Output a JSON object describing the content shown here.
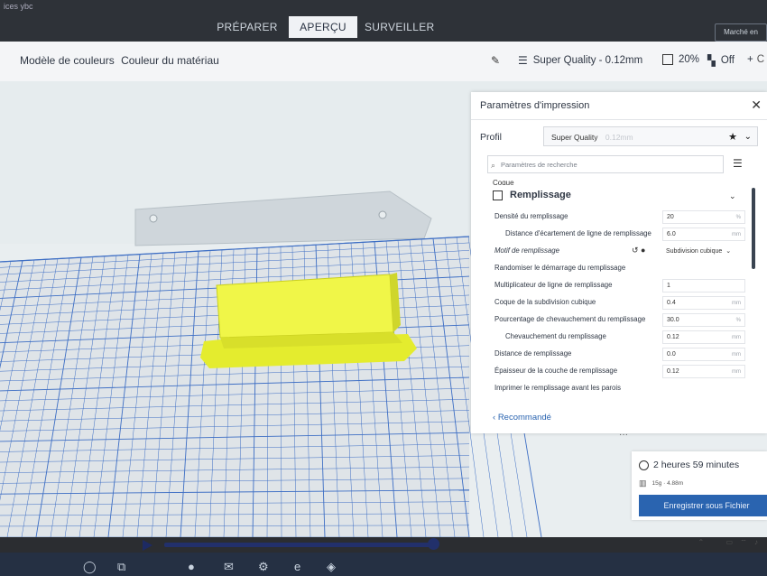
{
  "window": {
    "title_fragment": "ices ybc"
  },
  "stages": [
    {
      "label": "PRÉPARER",
      "active": false
    },
    {
      "label": "APERÇU",
      "active": true
    },
    {
      "label": "SURVEILLER",
      "active": false
    }
  ],
  "top_right_button": "Marché en ligne",
  "header": {
    "color_scheme_label": "Modèle de couleurs",
    "color_scheme_value": "Couleur du matériau",
    "quality": "Super Quality - 0.12mm",
    "infill": "20%",
    "support": "Off"
  },
  "print_settings": {
    "title": "Paramètres d'impression",
    "profile_label": "Profil",
    "profile_value": "Super Quality",
    "profile_suffix": "0.12mm",
    "search_placeholder": "Paramètres de recherche",
    "prev_section": "Coque",
    "section": "Remplissage",
    "rows": [
      {
        "label": "Densité du remplissage",
        "value": "20",
        "unit": "%",
        "indent": false
      },
      {
        "label": "Distance d'écartement de ligne de remplissage",
        "value": "6.0",
        "unit": "mm",
        "indent": true
      },
      {
        "label": "Motif de remplissage",
        "value": "Subdivision cubique",
        "dropdown": true,
        "italic": true
      },
      {
        "label": "Randomiser le démarrage du remplissage",
        "value": "",
        "unit": ""
      },
      {
        "label": "Multiplicateur de ligne de remplissage",
        "value": "1",
        "unit": ""
      },
      {
        "label": "Coque de la subdivision cubique",
        "value": "0.4",
        "unit": "mm"
      },
      {
        "label": "Pourcentage de chevauchement du remplissage",
        "value": "30.0",
        "unit": "%"
      },
      {
        "label": "Chevauchement du remplissage",
        "value": "0.12",
        "unit": "mm",
        "indent": true
      },
      {
        "label": "Distance de remplissage",
        "value": "0.0",
        "unit": "mm"
      },
      {
        "label": "Épaisseur de la couche de remplissage",
        "value": "0.12",
        "unit": "mm"
      },
      {
        "label": "Imprimer le remplissage avant les parois",
        "value": "",
        "unit": ""
      }
    ],
    "recommended_label": "Recommandé"
  },
  "estimate": {
    "time": "2 heures 59 minutes",
    "material": "15g · 4.88m",
    "save_label": "Enregistrer sous Fichier"
  },
  "colors": {
    "accent": "#2a64b0",
    "model": "#e8f03a",
    "plate_line": "#3d6ec4"
  }
}
